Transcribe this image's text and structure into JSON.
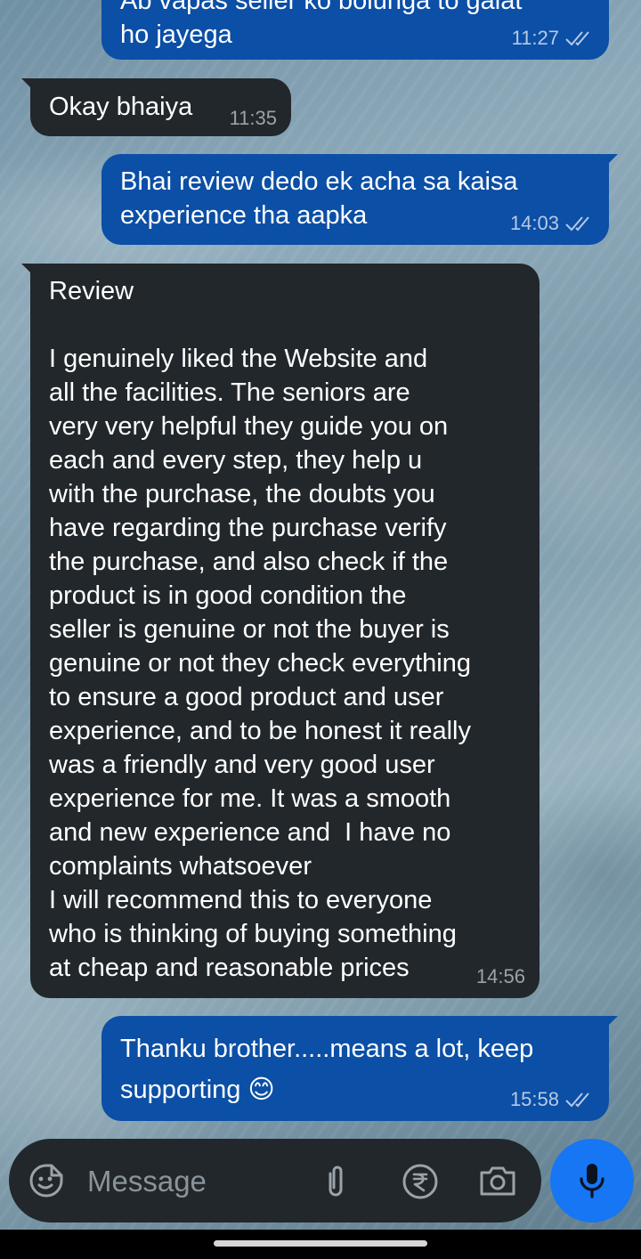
{
  "messages": [
    {
      "direction": "outgoing",
      "text": "Ab vapas seller ko bolunga to galat\nho jayega",
      "time": "11:27",
      "status": "read"
    },
    {
      "direction": "incoming",
      "text": "Okay bhaiya",
      "time": "11:35"
    },
    {
      "direction": "outgoing",
      "text": "Bhai review dedo ek acha sa kaisa\nexperience tha aapka",
      "time": "14:03",
      "status": "read"
    },
    {
      "direction": "incoming",
      "text": "Review\n\nI genuinely liked the Website and\nall the facilities. The seniors are\nvery very helpful they guide you on\neach and every step, they help u\nwith the purchase, the doubts you\nhave regarding the purchase verify\nthe purchase, and also check if the\nproduct is in good condition the\nseller is genuine or not the buyer is\ngenuine or not they check everything\nto ensure a good product and user\nexperience, and to be honest it really\nwas a friendly and very good user\nexperience for me. It was a smooth\nand new experience and  I have no\ncomplaints whatsoever\nI will recommend this to everyone\nwho is thinking of buying something\nat cheap and reasonable prices",
      "time": "14:56"
    },
    {
      "direction": "outgoing",
      "text": "Thanku brother.....means a lot, keep\nsupporting 😊",
      "time": "15:58",
      "status": "read"
    }
  ],
  "composer": {
    "placeholder": "Message",
    "icons": [
      "emoji-sticker-icon",
      "paperclip-icon",
      "rupee-payment-icon",
      "camera-icon",
      "microphone-icon"
    ]
  },
  "colors": {
    "outgoing_bubble": "#0b4fa6",
    "incoming_bubble": "#22272b",
    "mic_button": "#1676f3"
  }
}
